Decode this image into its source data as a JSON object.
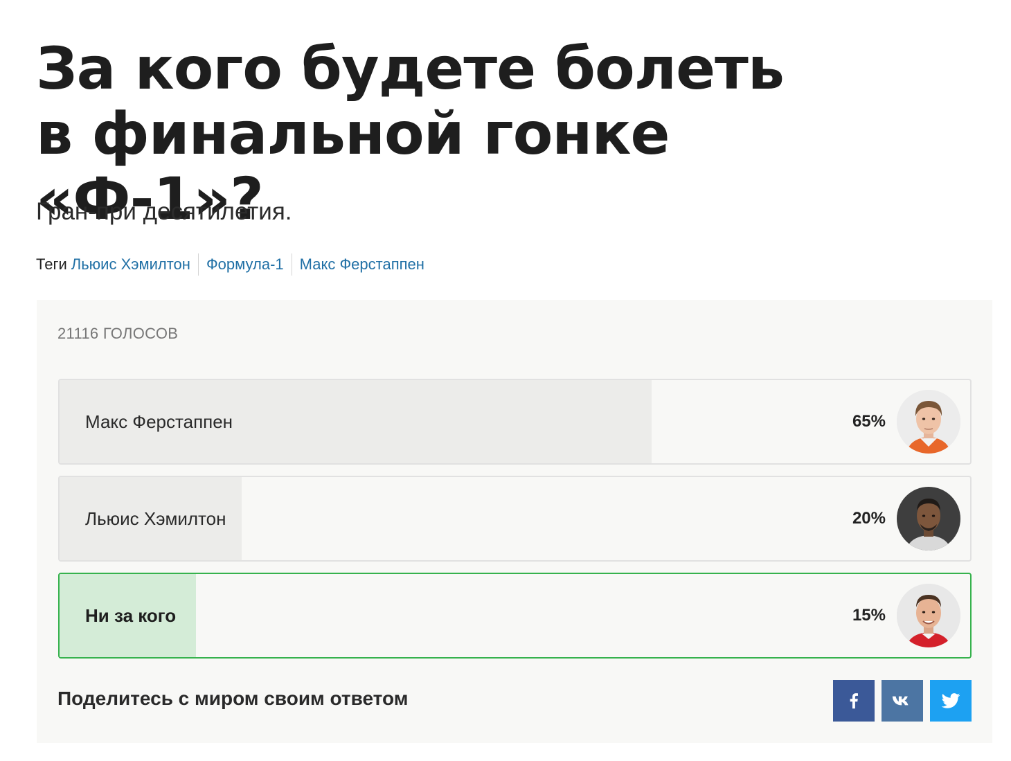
{
  "article": {
    "title": "За кого будете болеть в финальной гонке «Ф-1»?",
    "subtitle": "Гран-при десятилетия.",
    "tags_label": "Теги",
    "tags": [
      "Льюис Хэмилтон",
      "Формула-1",
      "Макс Ферстаппен"
    ]
  },
  "poll": {
    "votes_label": "21116 ГОЛОСОВ",
    "options": [
      {
        "label": "Макс Ферстаппен",
        "percent_label": "65%",
        "percent": 65,
        "selected": false,
        "avatar": "max-verstappen-photo"
      },
      {
        "label": "Льюис Хэмилтон",
        "percent_label": "20%",
        "percent": 20,
        "selected": false,
        "avatar": "lewis-hamilton-photo"
      },
      {
        "label": "Ни за кого",
        "percent_label": "15%",
        "percent": 15,
        "selected": true,
        "avatar": "michael-schumacher-photo"
      }
    ],
    "share_text": "Поделитесь с миром своим ответом"
  },
  "share_buttons": [
    {
      "network": "facebook",
      "icon": "facebook-icon",
      "color": "#3b5998"
    },
    {
      "network": "vk",
      "icon": "vk-icon",
      "color": "#4c75a3"
    },
    {
      "network": "twitter",
      "icon": "twitter-icon",
      "color": "#1da1f2"
    }
  ],
  "colors": {
    "selected_border": "#36b24d",
    "selected_fill": "#d4ecd7",
    "link": "#1f6fa5"
  }
}
